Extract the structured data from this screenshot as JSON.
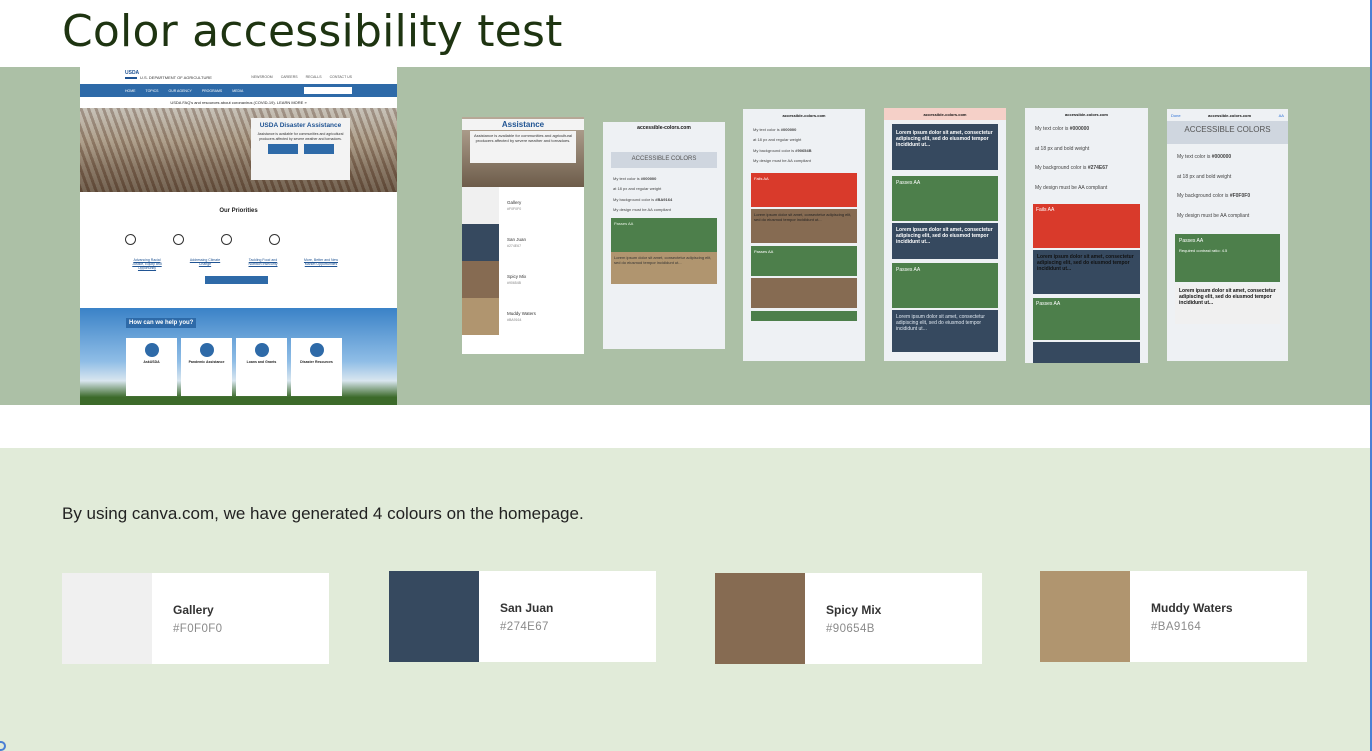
{
  "page": {
    "title": "Color accessibility test"
  },
  "usda": {
    "logo": "USDA",
    "dept": "U.S. DEPARTMENT OF AGRICULTURE",
    "top_links": [
      "NEWSROOM",
      "CAREERS",
      "RECALLS",
      "CONTACT US"
    ],
    "nav": [
      "HOME",
      "TOPICS",
      "OUR AGENCY",
      "PROGRAMS",
      "MEDIA"
    ],
    "alert": "USDA FAQ's and resources about coronavirus (COVID-19). LEARN MORE »",
    "hero_title": "USDA Disaster Assistance",
    "hero_text": "Assistance is available for communities and agricultural producers affected by severe weather and tornadoes.",
    "priorities_title": "Our Priorities",
    "priorities": [
      "Advancing Racial Justice, Equity and Opportunity",
      "Addressing Climate Change",
      "Tackling Food and Nutrition Insecurity",
      "More, Better and New Market Opportunities"
    ],
    "priorities_button": "Learn more about our priorities",
    "help_title": "How can we help you?",
    "help_tiles": [
      "AskUSDA",
      "Pandemic Assistance",
      "Loans and Grants",
      "Disaster Resources"
    ]
  },
  "mockups": {
    "assistance_title": "Assistance",
    "assistance_text": "Assistance is available for communities and agricultural producers affected by severe weather and tornadoes.",
    "browser_done": "Done",
    "browser_url": "accessible-colors.com",
    "browser_aa": "AA",
    "app_title": "ACCESSIBLE COLORS",
    "text_color_label": "My text color is",
    "text_color_value": "#000000",
    "size_line": "at 18 px and regular weight",
    "size_line_bold": "at 18 px and bold weight",
    "background_label": "My background color is",
    "bg_values": [
      "#BA9164",
      "#90654B",
      "#274E67",
      "#F0F0F0"
    ],
    "design_line": "My design must be AA compliant",
    "passes": "Passes AA",
    "fails": "Fails AA",
    "required_ratio": "Required contrast ratio: 4.5",
    "lorem": "Lorem ipsum dolor sit amet, consectetur adipiscing elit, sed do eiusmod tempor incididunt ut..."
  },
  "intro_text": "By using canva.com, we have generated 4 colours on the homepage.",
  "swatches": [
    {
      "name": "Gallery",
      "hex": "#F0F0F0",
      "color": "#f0f0f0"
    },
    {
      "name": "San Juan",
      "hex": "#274E67",
      "color": "#36495f"
    },
    {
      "name": "Spicy Mix",
      "hex": "#90654B",
      "color": "#866b52"
    },
    {
      "name": "Muddy Waters",
      "hex": "#BA9164",
      "color": "#b0956f"
    }
  ],
  "colors": {
    "title": "#1e3411",
    "band": "#acc0a6",
    "lower_bg": "#e1ebd9",
    "pass_green": "#4d7f4b",
    "fail_red": "#d93a2b",
    "navy": "#36495f",
    "brown": "#866b52"
  }
}
